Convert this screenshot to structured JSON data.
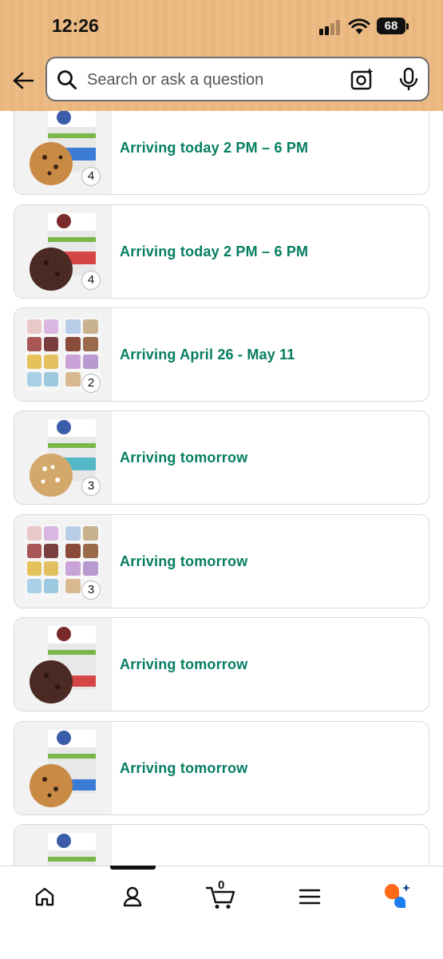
{
  "status_bar": {
    "time": "12:26",
    "battery": "68"
  },
  "search": {
    "placeholder": "Search or ask a question",
    "value": ""
  },
  "orders": [
    {
      "delivery": "Arriving today 2 PM – 6 PM",
      "quantity": "4",
      "thumb": "chocolate-chip"
    },
    {
      "delivery": "Arriving today 2 PM – 6 PM",
      "quantity": "4",
      "thumb": "double-chocolate"
    },
    {
      "delivery": "Arriving April 26 - May 11",
      "quantity": "2",
      "thumb": "variety-pack"
    },
    {
      "delivery": "Arriving tomorrow",
      "quantity": "3",
      "thumb": "white-chip"
    },
    {
      "delivery": "Arriving tomorrow",
      "quantity": "3",
      "thumb": "variety-pack"
    },
    {
      "delivery": "Arriving tomorrow",
      "quantity": "",
      "thumb": "double-chocolate"
    },
    {
      "delivery": "Arriving tomorrow",
      "quantity": "",
      "thumb": "chocolate-chip"
    },
    {
      "delivery": "",
      "quantity": "",
      "thumb": "chocolate-chip"
    }
  ],
  "bottom_nav": {
    "cart_count": "0",
    "items": [
      "home-icon",
      "account-icon",
      "cart-icon",
      "menu-icon",
      "rufus-icon"
    ]
  },
  "colors": {
    "header_bg": "#ecbc86",
    "delivery_text": "#067d62",
    "rufus_orange": "#ff6a1a",
    "rufus_blue": "#1a7ef0"
  }
}
